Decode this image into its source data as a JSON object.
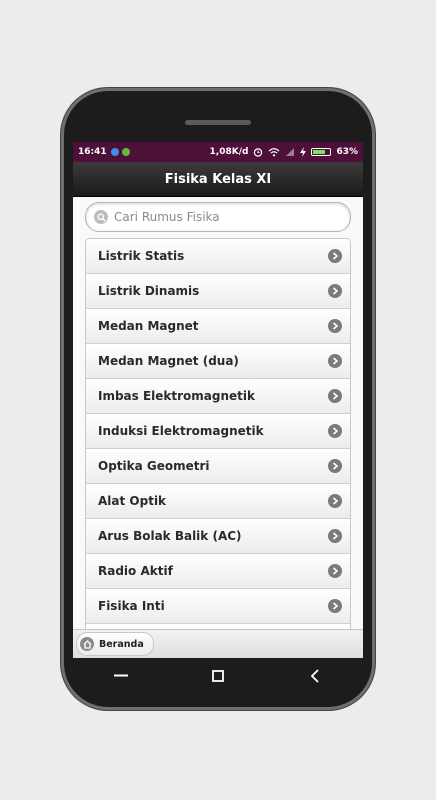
{
  "status_bar": {
    "time": "16:41",
    "net_speed": "1,08K/d",
    "battery": "63%",
    "battery_level": 0.63,
    "bg_color": "#4e0f38"
  },
  "app_bar": {
    "title": "Fisika Kelas XI"
  },
  "search": {
    "placeholder": "Cari Rumus Fisika",
    "icon": "search-icon"
  },
  "list": {
    "items": [
      {
        "label": "Listrik Statis"
      },
      {
        "label": "Listrik Dinamis"
      },
      {
        "label": "Medan Magnet"
      },
      {
        "label": "Medan Magnet (dua)"
      },
      {
        "label": "Imbas Elektromagnetik"
      },
      {
        "label": "Induksi Elektromagnetik"
      },
      {
        "label": "Optika Geometri"
      },
      {
        "label": "Alat Optik"
      },
      {
        "label": "Arus Bolak Balik (AC)"
      },
      {
        "label": "Radio Aktif"
      },
      {
        "label": "Fisika Inti"
      }
    ],
    "arrow_icon": "chevron-right-circle-icon"
  },
  "footer": {
    "home_label": "Beranda",
    "home_icon": "home-icon"
  },
  "nav": {
    "recent_icon": "recent-apps-icon",
    "home_icon": "home-square-icon",
    "back_icon": "back-icon"
  }
}
